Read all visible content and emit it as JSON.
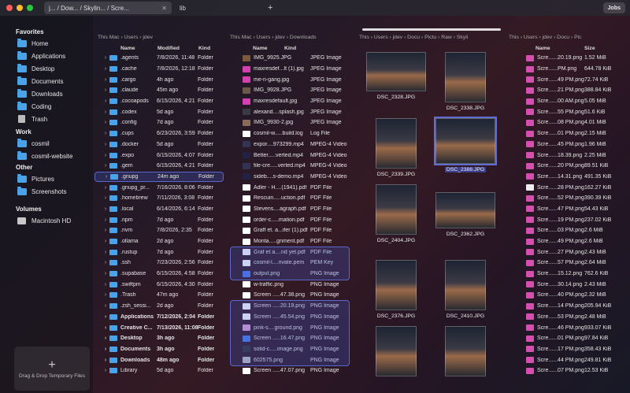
{
  "window": {
    "tabs": [
      {
        "label": "j... / Dow... / Skylin... / Scre..."
      },
      {
        "label": "lib"
      }
    ],
    "jobs_label": "Jobs",
    "plus": "+",
    "close": "✕"
  },
  "sidebar": {
    "favorites_title": "Favorites",
    "favorites": [
      {
        "label": "Home"
      },
      {
        "label": "Applications"
      },
      {
        "label": "Desktop"
      },
      {
        "label": "Documents"
      },
      {
        "label": "Downloads"
      },
      {
        "label": "Coding"
      },
      {
        "label": "Trash"
      }
    ],
    "work_title": "Work",
    "work": [
      {
        "label": "cosmil"
      },
      {
        "label": "cosmil-website"
      }
    ],
    "other_title": "Other",
    "other": [
      {
        "label": "Pictures"
      },
      {
        "label": "Screenshots"
      }
    ],
    "volumes_title": "Volumes",
    "volumes": [
      {
        "label": "Macintosh HD"
      }
    ],
    "drop_plus": "+",
    "drop_label": "Drag & Drop Temporary Files"
  },
  "pane1": {
    "crumb": "This Mac  ›  Users  ›  jdev",
    "headers": {
      "name": "Name",
      "modified": "Modified",
      "kind": "Kind"
    },
    "rows": [
      {
        "name": ".agents",
        "modified": "7/8/2026, 11:48",
        "kind": "Folder"
      },
      {
        "name": ".cache",
        "modified": "7/8/2026, 12:18",
        "kind": "Folder"
      },
      {
        "name": ".cargo",
        "modified": "4h ago",
        "kind": "Folder"
      },
      {
        "name": ".claude",
        "modified": "45m ago",
        "kind": "Folder"
      },
      {
        "name": ".cocoapods",
        "modified": "6/15/2026, 4:21",
        "kind": "Folder"
      },
      {
        "name": ".codex",
        "modified": "5d ago",
        "kind": "Folder"
      },
      {
        "name": ".config",
        "modified": "7d ago",
        "kind": "Folder"
      },
      {
        "name": ".cups",
        "modified": "6/23/2026, 3:59",
        "kind": "Folder"
      },
      {
        "name": ".docker",
        "modified": "5d ago",
        "kind": "Folder"
      },
      {
        "name": ".expo",
        "modified": "6/15/2026, 4:07",
        "kind": "Folder"
      },
      {
        "name": ".gem",
        "modified": "6/15/2026, 4:21",
        "kind": "Folder"
      },
      {
        "name": ".gnupg",
        "modified": "24m ago",
        "kind": "Folder"
      },
      {
        "name": ".gnupg_pr...",
        "modified": "7/16/2026, 8:06",
        "kind": "Folder"
      },
      {
        "name": ".homebrew",
        "modified": "7/11/2026, 3:08",
        "kind": "Folder"
      },
      {
        "name": ".local",
        "modified": "6/14/2026, 6:14",
        "kind": "Folder"
      },
      {
        "name": ".npm",
        "modified": "7d ago",
        "kind": "Folder"
      },
      {
        "name": ".nvm",
        "modified": "7/8/2026, 2:35",
        "kind": "Folder"
      },
      {
        "name": ".ollama",
        "modified": "2d ago",
        "kind": "Folder"
      },
      {
        "name": ".rustup",
        "modified": "7d ago",
        "kind": "Folder"
      },
      {
        "name": ".ssh",
        "modified": "7/23/2026, 2:56",
        "kind": "Folder"
      },
      {
        "name": ".supabase",
        "modified": "6/15/2026, 4:58",
        "kind": "Folder"
      },
      {
        "name": ".swiftpm",
        "modified": "6/15/2026, 4:30",
        "kind": "Folder"
      },
      {
        "name": ".Trash",
        "modified": "47m ago",
        "kind": "Folder"
      },
      {
        "name": ".zsh_sessi...",
        "modified": "2d ago",
        "kind": "Folder"
      },
      {
        "name": "Applications",
        "modified": "7/12/2026, 2:04",
        "kind": "Folder"
      },
      {
        "name": "Creative C...",
        "modified": "7/13/2026, 11:08",
        "kind": "Folder"
      },
      {
        "name": "Desktop",
        "modified": "3h ago",
        "kind": "Folder"
      },
      {
        "name": "Documents",
        "modified": "3h ago",
        "kind": "Folder"
      },
      {
        "name": "Downloads",
        "modified": "48m ago",
        "kind": "Folder"
      },
      {
        "name": "Library",
        "modified": "5d ago",
        "kind": "Folder"
      }
    ]
  },
  "pane2": {
    "crumb": "This Mac  ›  Users  ›  jdev  ›  Downloads",
    "headers": {
      "name": "Name",
      "kind": "Kind"
    },
    "rows": [
      {
        "name": "IMG_9925.JPG",
        "kind": "JPEG Image"
      },
      {
        "name": "maxresdef...lt (1).jpg",
        "kind": "JPEG Image"
      },
      {
        "name": "me-n-gang.jpg",
        "kind": "JPEG Image"
      },
      {
        "name": "IMG_9928.JPG",
        "kind": "JPEG Image"
      },
      {
        "name": "maxresdefault.jpg",
        "kind": "JPEG Image"
      },
      {
        "name": "alexand....splash.jpg",
        "kind": "JPEG Image"
      },
      {
        "name": "IMG_9930-2.jpg",
        "kind": "JPEG Image"
      },
      {
        "name": "cosmil-w.....build.log",
        "kind": "Log File"
      },
      {
        "name": "expor....973299.mp4",
        "kind": "MPEG-4 Video"
      },
      {
        "name": "Better.....verted.mp4",
        "kind": "MPEG-4 Video"
      },
      {
        "name": "file-cre.....verted.mp4",
        "kind": "MPEG-4 Video"
      },
      {
        "name": "sideb....s-demo.mp4",
        "kind": "MPEG-4 Video"
      },
      {
        "name": "Adler - H....(1941).pdf",
        "kind": "PDF File"
      },
      {
        "name": "Rescuin.....uction.pdf",
        "kind": "PDF File"
      },
      {
        "name": "Stevens....agraph.pdf",
        "kind": "PDF File"
      },
      {
        "name": "order-c.....mation.pdf",
        "kind": "PDF File"
      },
      {
        "name": "Graff et. a...ifer (1).pdf",
        "kind": "PDF File"
      },
      {
        "name": "Monta.....gnment.pdf",
        "kind": "PDF File"
      },
      {
        "name": "Graf et a....nd yet.pdf",
        "kind": "PDF File"
      },
      {
        "name": "cosmil-l....rivate.pem",
        "kind": "PEM Key"
      },
      {
        "name": "output.png",
        "kind": "PNG Image"
      },
      {
        "name": "w-traffic.png",
        "kind": "PNG Image"
      },
      {
        "name": "Screen .....47.38.png",
        "kind": "PNG Image"
      },
      {
        "name": "Screen .....20.19.png",
        "kind": "PNG Image"
      },
      {
        "name": "Screen .....45.54.png",
        "kind": "PNG Image"
      },
      {
        "name": "pink-s....ground.png",
        "kind": "PNG Image"
      },
      {
        "name": "Screen .....16.47.png",
        "kind": "PNG Image"
      },
      {
        "name": "solid-c.....image.png",
        "kind": "PNG Image"
      },
      {
        "name": "602575.png",
        "kind": "PNG Image"
      },
      {
        "name": "Screen .....47.07.png",
        "kind": "PNG Image"
      }
    ]
  },
  "pane3": {
    "crumb": "This  ›  Users  ›  jdev  ›  Docu  ›  Pictu  ›  Raw  ›  Skyli",
    "thumbs": [
      {
        "label": "DSC_2328.JPG"
      },
      {
        "label": "DSC_2338.JPG"
      },
      {
        "label": "DSC_2339.JPG"
      },
      {
        "label": "DSC_2388.JPG"
      },
      {
        "label": "DSC_2404.JPG"
      },
      {
        "label": "DSC_2362.JPG"
      },
      {
        "label": "DSC_2376.JPG"
      },
      {
        "label": "DSC_2410.JPG"
      },
      {
        "label": ""
      },
      {
        "label": ""
      }
    ]
  },
  "pane4": {
    "crumb": "This  ›  Users  ›  jdev  ›  Docu  ›  Pic",
    "headers": {
      "name": "Name",
      "size": "Size"
    },
    "rows": [
      {
        "name": "Scre......20.19.png",
        "size": "1.52 MiB"
      },
      {
        "name": "Scre......PM.png",
        "size": "644.78 KiB"
      },
      {
        "name": "Scre......49 PM.png",
        "size": "72.74 KiB"
      },
      {
        "name": "Scre......21 PM.png",
        "size": "388.84 KiB"
      },
      {
        "name": "Scre......00 AM.png",
        "size": "5.05 MiB"
      },
      {
        "name": "Scre......55 PM.png",
        "size": "51.6 KiB"
      },
      {
        "name": "Scre......08 PM.png",
        "size": "4.01 MiB"
      },
      {
        "name": "Scre......01 PM.png",
        "size": "2.15 MiB"
      },
      {
        "name": "Scre......45 PM.png",
        "size": "1.96 MiB"
      },
      {
        "name": "Scre......18.39.png",
        "size": "2.25 MiB"
      },
      {
        "name": "Scre......20 PM.png",
        "size": "89.51 KiB"
      },
      {
        "name": "Scre......14.31.png",
        "size": "491.35 KiB"
      },
      {
        "name": "Scre......28 PM.png",
        "size": "162.27 KiB"
      },
      {
        "name": "Scre......52 PM.png",
        "size": "390.39 KiB"
      },
      {
        "name": "Scre......47 PM.png",
        "size": "54.43 KiB"
      },
      {
        "name": "Scre......19 PM.png",
        "size": "237.02 KiB"
      },
      {
        "name": "Scre......03 PM.png",
        "size": "2.6 MiB"
      },
      {
        "name": "Scre......49 PM.png",
        "size": "2.6 MiB"
      },
      {
        "name": "Scre......27 PM.png",
        "size": "2.43 MiB"
      },
      {
        "name": "Scre......57 PM.png",
        "size": "2.64 MiB"
      },
      {
        "name": "Scre......15.12.png",
        "size": "762.6 KiB"
      },
      {
        "name": "Scre......30.14.png",
        "size": "2.43 MiB"
      },
      {
        "name": "Scre......40 PM.png",
        "size": "2.32 MiB"
      },
      {
        "name": "Scre......14 PM.png",
        "size": "205.94 KiB"
      },
      {
        "name": "Scre......53 PM.png",
        "size": "2.48 MiB"
      },
      {
        "name": "Scre......46 PM.png",
        "size": "933.07 KiB"
      },
      {
        "name": "Scre......01 PM.png",
        "size": "97.84 KiB"
      },
      {
        "name": "Scre......17 PM.png",
        "size": "358.43 KiB"
      },
      {
        "name": "Scre......44 PM.png",
        "size": "249.81 KiB"
      },
      {
        "name": "Scre......07 PM.png",
        "size": "12.53 KiB"
      }
    ]
  }
}
